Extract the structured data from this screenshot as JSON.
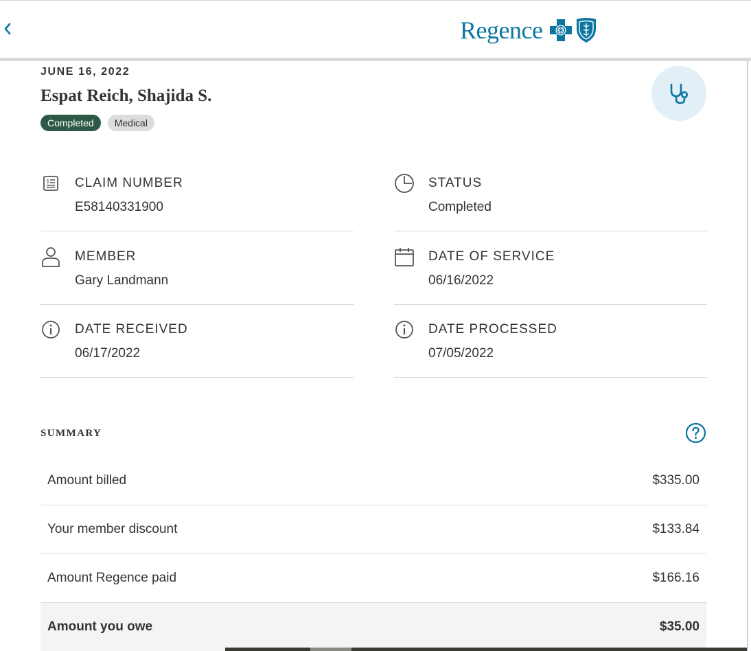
{
  "header": {
    "back_icon": "chevron-left-icon",
    "logo_text": "Regence",
    "logo_icons": [
      "blue-cross-icon",
      "blue-shield-icon"
    ],
    "accent_color": "#0b76a0"
  },
  "claim": {
    "date": "JUNE 16, 2022",
    "provider": "Espat Reich, Shajida S.",
    "badges": {
      "status": "Completed",
      "type": "Medical"
    },
    "provider_icon": "stethoscope-icon",
    "status_badge_color": "#2e5946"
  },
  "details": {
    "claim_number": {
      "label": "CLAIM NUMBER",
      "value": "E58140331900",
      "icon": "receipt-icon"
    },
    "status": {
      "label": "STATUS",
      "value": "Completed",
      "icon": "clock-icon"
    },
    "member": {
      "label": "MEMBER",
      "value": "Gary Landmann",
      "icon": "person-icon"
    },
    "date_of_service": {
      "label": "DATE OF SERVICE",
      "value": "06/16/2022",
      "icon": "calendar-icon"
    },
    "date_received": {
      "label": "DATE RECEIVED",
      "value": "06/17/2022",
      "icon": "info-icon"
    },
    "date_processed": {
      "label": "DATE PROCESSED",
      "value": "07/05/2022",
      "icon": "info-icon"
    }
  },
  "summary": {
    "title": "SUMMARY",
    "help_icon": "question-circle-icon",
    "rows": [
      {
        "label": "Amount billed",
        "amount": "$335.00"
      },
      {
        "label": "Your member discount",
        "amount": "$133.84"
      },
      {
        "label": "Amount Regence paid",
        "amount": "$166.16"
      },
      {
        "label": "Amount you owe",
        "amount": "$35.00"
      }
    ]
  }
}
